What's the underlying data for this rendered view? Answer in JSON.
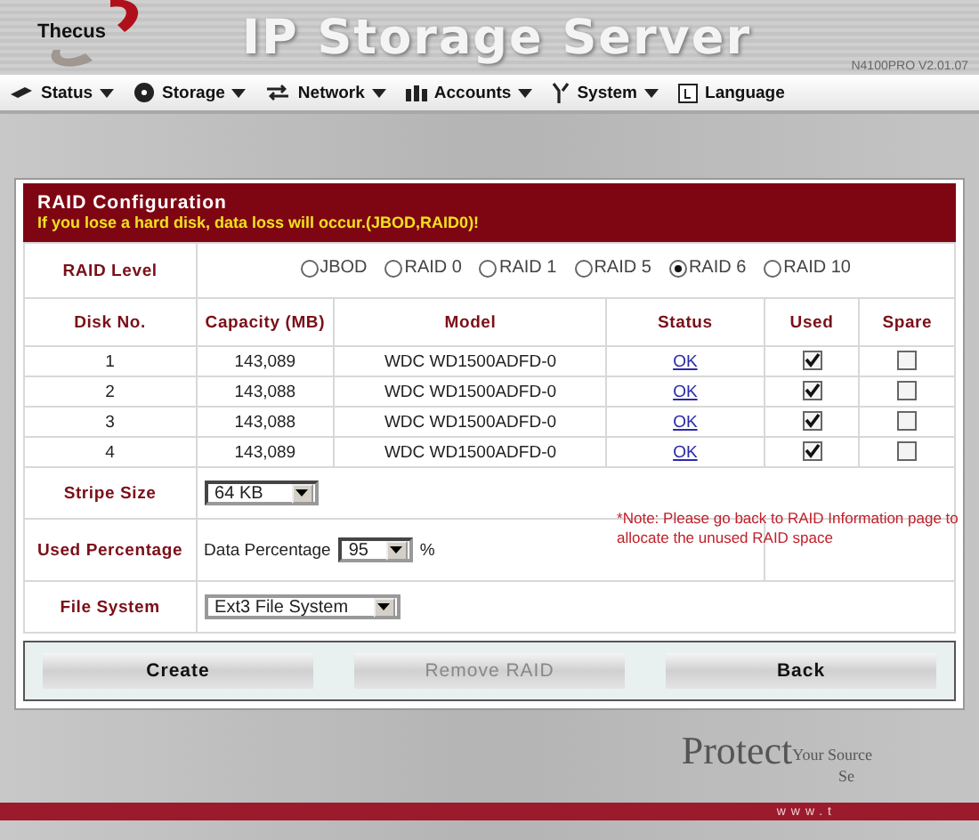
{
  "header": {
    "logo": "Thecus",
    "title": "IP Storage Server",
    "version": "N4100PRO V2.01.07"
  },
  "menu": [
    {
      "label": "Status",
      "dropdown": true
    },
    {
      "label": "Storage",
      "dropdown": true
    },
    {
      "label": "Network",
      "dropdown": true
    },
    {
      "label": "Accounts",
      "dropdown": true
    },
    {
      "label": "System",
      "dropdown": true
    },
    {
      "label": "Language",
      "dropdown": false
    }
  ],
  "panel": {
    "title": "RAID Configuration",
    "warning": "If you lose a hard disk, data loss will occur.(JBOD,RAID0)!"
  },
  "raid_level": {
    "label": "RAID Level",
    "options": [
      {
        "label": "JBOD",
        "selected": false
      },
      {
        "label": "RAID 0",
        "selected": false
      },
      {
        "label": "RAID 1",
        "selected": false
      },
      {
        "label": "RAID 5",
        "selected": false
      },
      {
        "label": "RAID 6",
        "selected": true
      },
      {
        "label": "RAID 10",
        "selected": false
      }
    ]
  },
  "table": {
    "columns": [
      "Disk No.",
      "Capacity (MB)",
      "Model",
      "Status",
      "Used",
      "Spare"
    ],
    "rows": [
      {
        "disk": "1",
        "capacity": "143,089",
        "model": "WDC WD1500ADFD-0",
        "status": "OK",
        "used": true,
        "spare": false
      },
      {
        "disk": "2",
        "capacity": "143,088",
        "model": "WDC WD1500ADFD-0",
        "status": "OK",
        "used": true,
        "spare": false
      },
      {
        "disk": "3",
        "capacity": "143,088",
        "model": "WDC WD1500ADFD-0",
        "status": "OK",
        "used": true,
        "spare": false
      },
      {
        "disk": "4",
        "capacity": "143,089",
        "model": "WDC WD1500ADFD-0",
        "status": "OK",
        "used": true,
        "spare": false
      }
    ]
  },
  "stripe_size": {
    "label": "Stripe Size",
    "value": "64 KB"
  },
  "used_percentage": {
    "label": "Used Percentage",
    "field_label": "Data Percentage",
    "value": "95",
    "unit": "%",
    "note": "*Note: Please go back to RAID Information page to allocate the unused RAID space"
  },
  "file_system": {
    "label": "File System",
    "value": "Ext3 File System"
  },
  "buttons": [
    {
      "label": "Create",
      "disabled": false
    },
    {
      "label": "Remove RAID",
      "disabled": true
    },
    {
      "label": "Back",
      "disabled": false
    }
  ],
  "footer": {
    "slogan_big": "Protect",
    "slogan_small": "Your Source",
    "slogan_line2": "Se",
    "url": "www.t"
  }
}
